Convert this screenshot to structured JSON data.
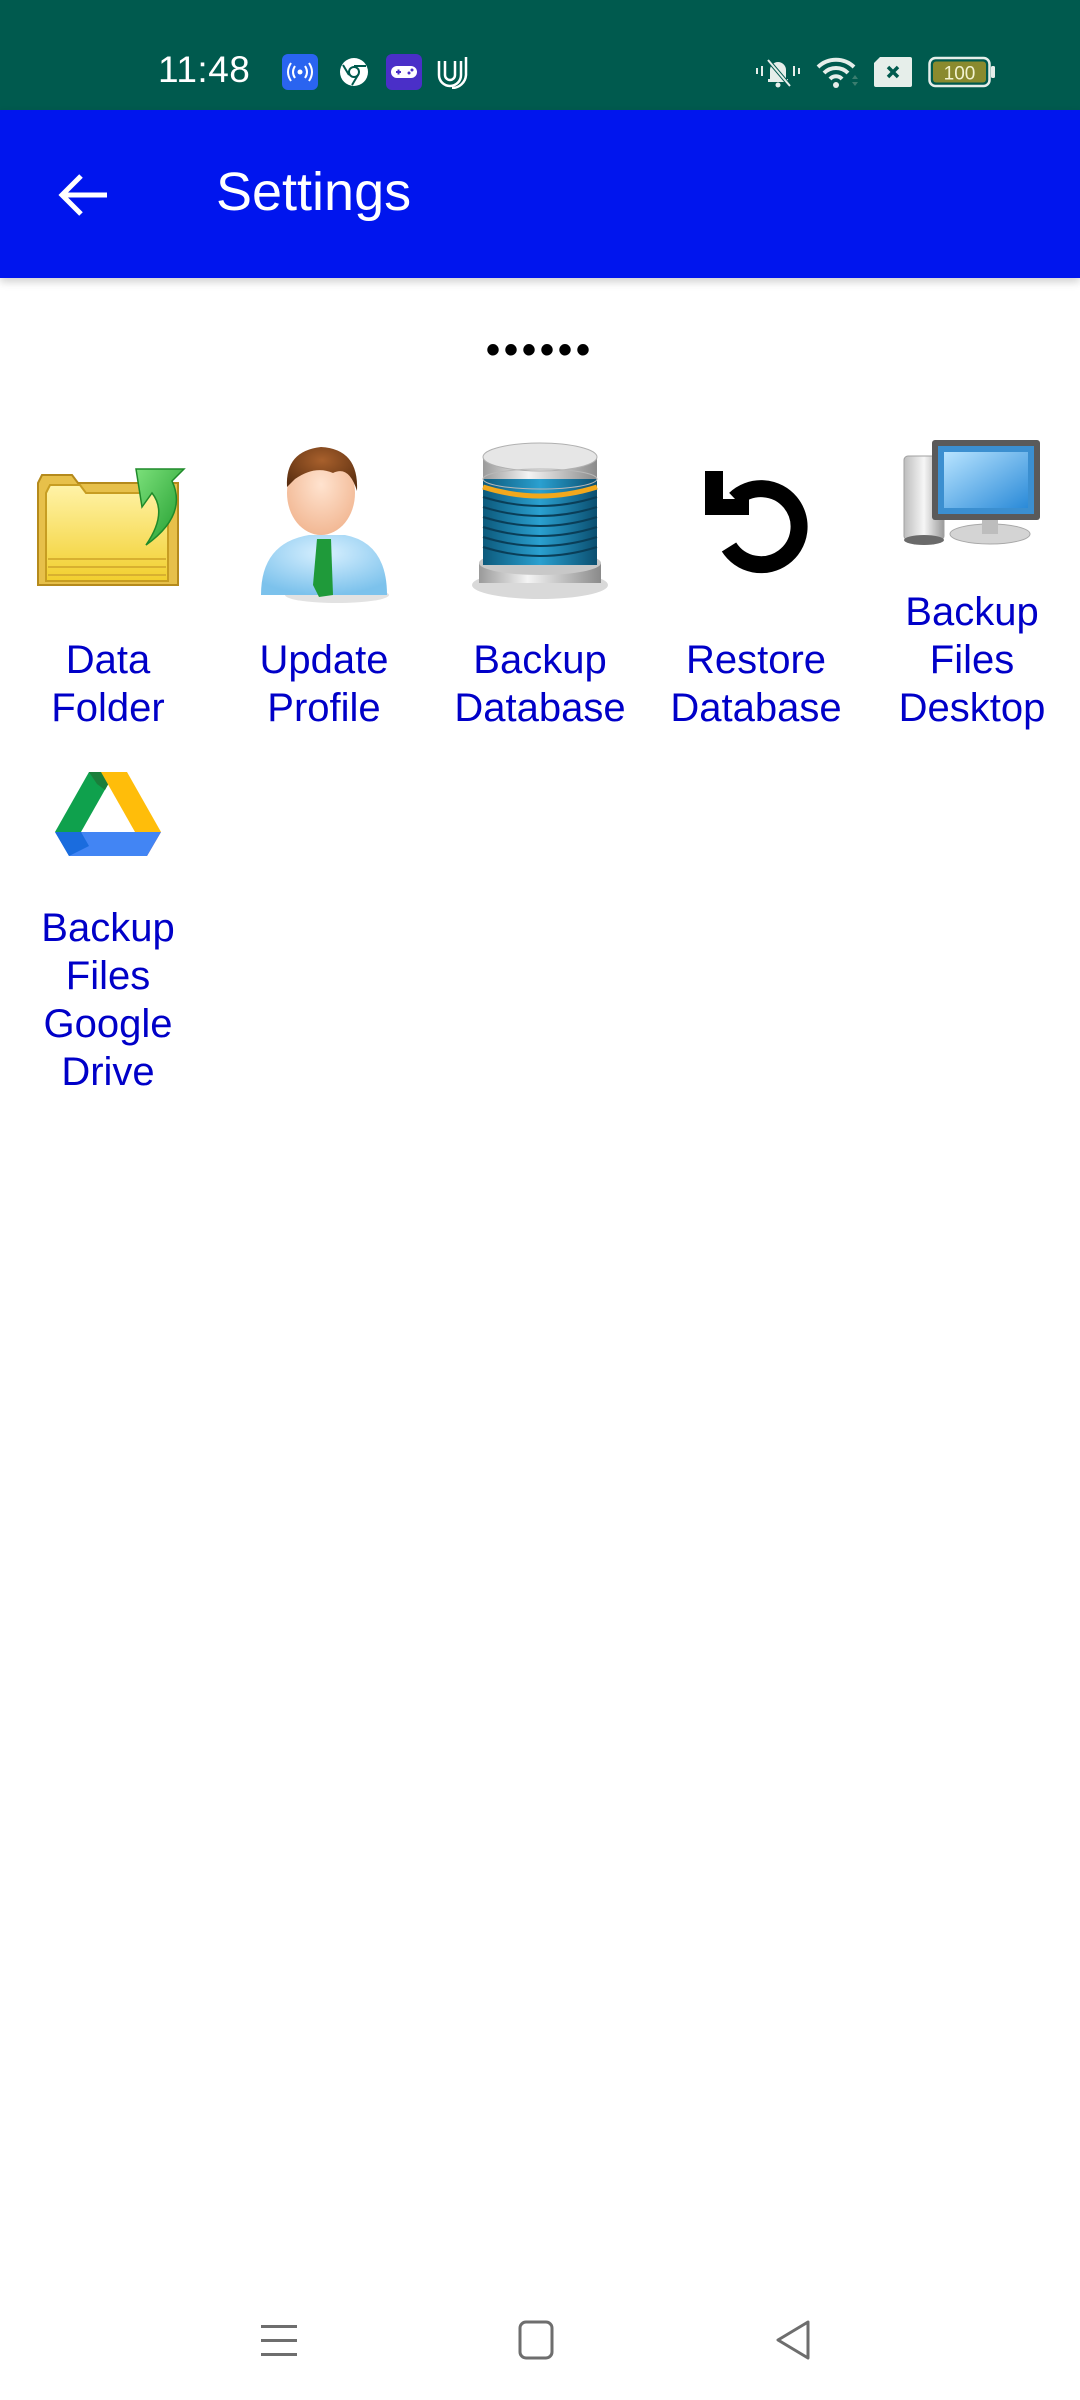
{
  "status_bar": {
    "time": "11:48",
    "notification_icons": [
      "hotspot-icon",
      "chrome-icon",
      "game-controller-icon",
      "u-app-icon"
    ],
    "system_icons": [
      "vibrate-silent-icon",
      "wifi-icon",
      "no-sim-icon",
      "battery-icon"
    ],
    "battery_level": "100"
  },
  "app_bar": {
    "back_icon": "arrow-left-icon",
    "title": "Settings",
    "color": "#0015ee"
  },
  "page_indicator": "••••••",
  "tiles": [
    {
      "id": "data-folder",
      "icon": "folder-arrow-icon",
      "label_lines": [
        "Data",
        "Folder"
      ]
    },
    {
      "id": "update-profile",
      "icon": "user-profile-icon",
      "label_lines": [
        "Update",
        "Profile"
      ]
    },
    {
      "id": "backup-database",
      "icon": "database-icon",
      "label_lines": [
        "Backup",
        "Database"
      ]
    },
    {
      "id": "restore-database",
      "icon": "restore-icon",
      "label_lines": [
        "Restore",
        "Database"
      ]
    },
    {
      "id": "backup-files-desktop",
      "icon": "desktop-computer-icon",
      "label_lines": [
        "Backup",
        "Files",
        "Desktop"
      ]
    },
    {
      "id": "backup-files-google-drive",
      "icon": "google-drive-icon",
      "label_lines": [
        "Backup",
        "Files",
        "Google",
        "Drive"
      ]
    }
  ],
  "colors": {
    "status_bar": "#005a4e",
    "label_text": "#0000c8"
  },
  "nav_bar": {
    "buttons": [
      "recents-icon",
      "home-icon",
      "back-icon"
    ]
  }
}
